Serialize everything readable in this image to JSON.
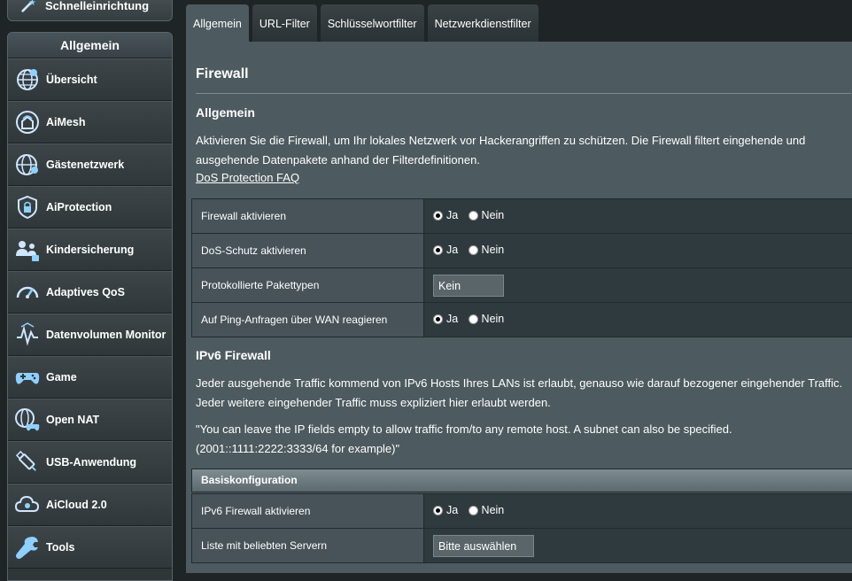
{
  "sidebar": {
    "quick_setup_label": "Schnelleinrichtung",
    "section_header": "Allgemein",
    "items": [
      {
        "label": "Übersicht",
        "icon": "globe-network-icon"
      },
      {
        "label": "AiMesh",
        "icon": "aimesh-icon"
      },
      {
        "label": "Gästenetzwerk",
        "icon": "guest-network-icon"
      },
      {
        "label": "AiProtection",
        "icon": "shield-lock-icon"
      },
      {
        "label": "Kindersicherung",
        "icon": "parental-control-icon"
      },
      {
        "label": "Adaptives QoS",
        "icon": "speedometer-icon"
      },
      {
        "label": "Datenvolumen Monitor",
        "icon": "traffic-monitor-icon"
      },
      {
        "label": "Game",
        "icon": "gamepad-icon"
      },
      {
        "label": "Open NAT",
        "icon": "open-nat-icon"
      },
      {
        "label": "USB-Anwendung",
        "icon": "usb-icon"
      },
      {
        "label": "AiCloud 2.0",
        "icon": "cloud-icon"
      },
      {
        "label": "Tools",
        "icon": "wrench-icon"
      }
    ]
  },
  "tabs": [
    {
      "label": "Allgemein",
      "active": true
    },
    {
      "label": "URL-Filter",
      "active": false
    },
    {
      "label": "Schlüsselwortfilter",
      "active": false
    },
    {
      "label": "Netzwerkdienstfilter",
      "active": false
    }
  ],
  "main": {
    "title": "Firewall",
    "general": {
      "heading": "Allgemein",
      "description_line1": "Aktivieren Sie die Firewall, um Ihr lokales Netzwerk vor Hackerangriffen zu schützen. Die Firewall filtert eingehende und",
      "description_line2": "ausgehende Datenpakete anhand der Filterdefinitionen.",
      "faq_link": "DoS Protection FAQ",
      "rows": [
        {
          "label": "Firewall aktivieren",
          "yes": "Ja",
          "no": "Nein",
          "selected": "Ja"
        },
        {
          "label": "DoS-Schutz aktivieren",
          "yes": "Ja",
          "no": "Nein",
          "selected": "Ja"
        },
        {
          "label": "Protokollierte Pakettypen",
          "select_value": "Kein"
        },
        {
          "label": "Auf Ping-Anfragen über WAN reagieren",
          "yes": "Ja",
          "no": "Nein",
          "selected": "Ja"
        }
      ]
    },
    "ipv6": {
      "heading": "IPv6 Firewall",
      "description_line1": "Jeder ausgehende Traffic kommend von IPv6 Hosts Ihres LANs ist erlaubt, genauso wie darauf bezogener eingehender Traffic.",
      "description_line2": "Jeder weitere eingehender Traffic muss expliziert hier erlaubt werden.",
      "note_line1": "\"You can leave the IP fields empty to allow traffic from/to any remote host. A subnet can also be specified.",
      "note_line2": "(2001::1111:2222:3333/64 for example)\"",
      "basic_config_heading": "Basiskonfiguration",
      "rows": [
        {
          "label": "IPv6 Firewall aktivieren",
          "yes": "Ja",
          "no": "Nein",
          "selected": "Ja"
        },
        {
          "label": "Liste mit beliebten Servern",
          "select_value": "Bitte auswählen"
        }
      ]
    }
  }
}
